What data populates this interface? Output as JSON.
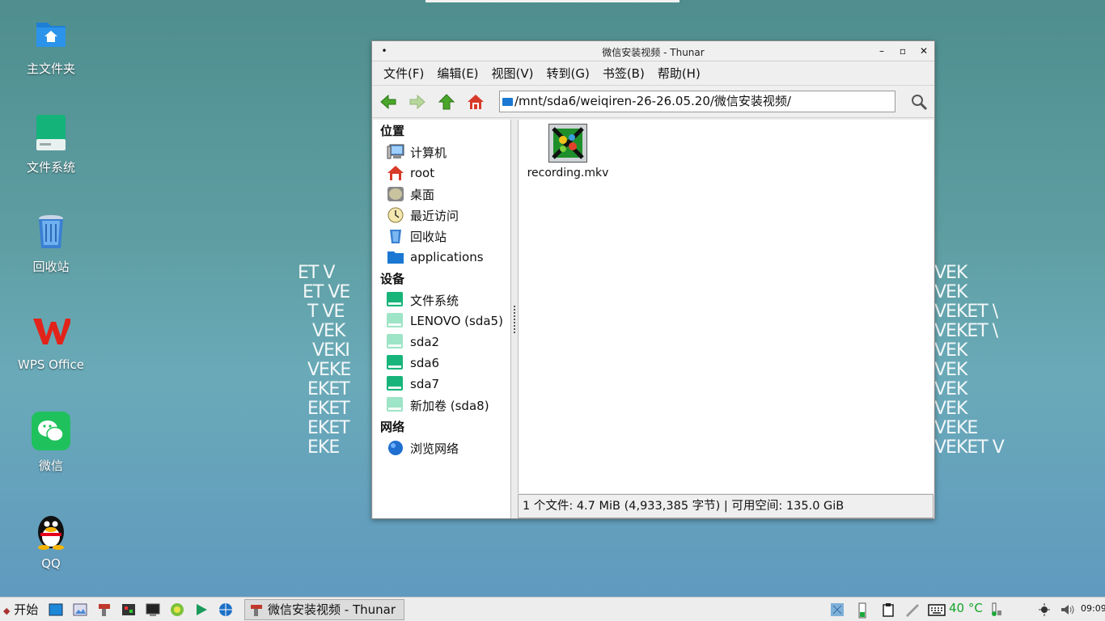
{
  "desktop": {
    "icons": [
      {
        "label": "主文件夹",
        "icon": "home-folder-icon"
      },
      {
        "label": "文件系统",
        "icon": "drive-icon"
      },
      {
        "label": "回收站",
        "icon": "trash-icon"
      },
      {
        "label": "WPS Office",
        "icon": "wps-icon"
      },
      {
        "label": "微信",
        "icon": "wechat-icon"
      },
      {
        "label": "QQ",
        "icon": "qq-icon"
      }
    ],
    "wallpaper_left": "ET V\n ET VE\n  T VE\n   VEK\n   VEKI\n  VEKE\n  EKET\n  EKET\n  EKET\n  EKE",
    "wallpaper_right": "VEK\nVEK\nVEKET \\\nVEKET \\\nVEK\nVEK\nVEK\nVEK\nVEKE\nVEKET V"
  },
  "window": {
    "title": "微信安装视频 - Thunar",
    "controls": {
      "menu": "•",
      "minimize": "–",
      "maximize": "▫",
      "close": "✕"
    },
    "menu": [
      "文件(F)",
      "编辑(E)",
      "视图(V)",
      "转到(G)",
      "书签(B)",
      "帮助(H)"
    ],
    "toolbar": {
      "back_icon": "back-arrow-icon",
      "forward_icon": "forward-arrow-icon",
      "up_icon": "up-arrow-icon",
      "home_icon": "home-icon",
      "location": "/mnt/sda6/weiqiren-26-26.05.20/微信安装视频/",
      "search_icon": "search-icon"
    },
    "sidebar": {
      "places_header": "位置",
      "places": [
        "计算机",
        "root",
        "桌面",
        "最近访问",
        "回收站",
        "applications"
      ],
      "devices_header": "设备",
      "devices": [
        "文件系统",
        "LENOVO (sda5)",
        "sda2",
        "sda6",
        "sda7",
        "新加卷 (sda8)"
      ],
      "network_header": "网络",
      "network": [
        "浏览网络"
      ]
    },
    "files": [
      {
        "name": "recording.mkv",
        "icon": "video-file-icon"
      }
    ],
    "status": "1 个文件: 4.7 MiB (4,933,385 字节)  |  可用空间: 135.0 GiB"
  },
  "taskbar": {
    "start_label": "开始",
    "task_label": "微信安装视频 - Thunar",
    "temperature": "40 °C",
    "clock": "09:09"
  }
}
